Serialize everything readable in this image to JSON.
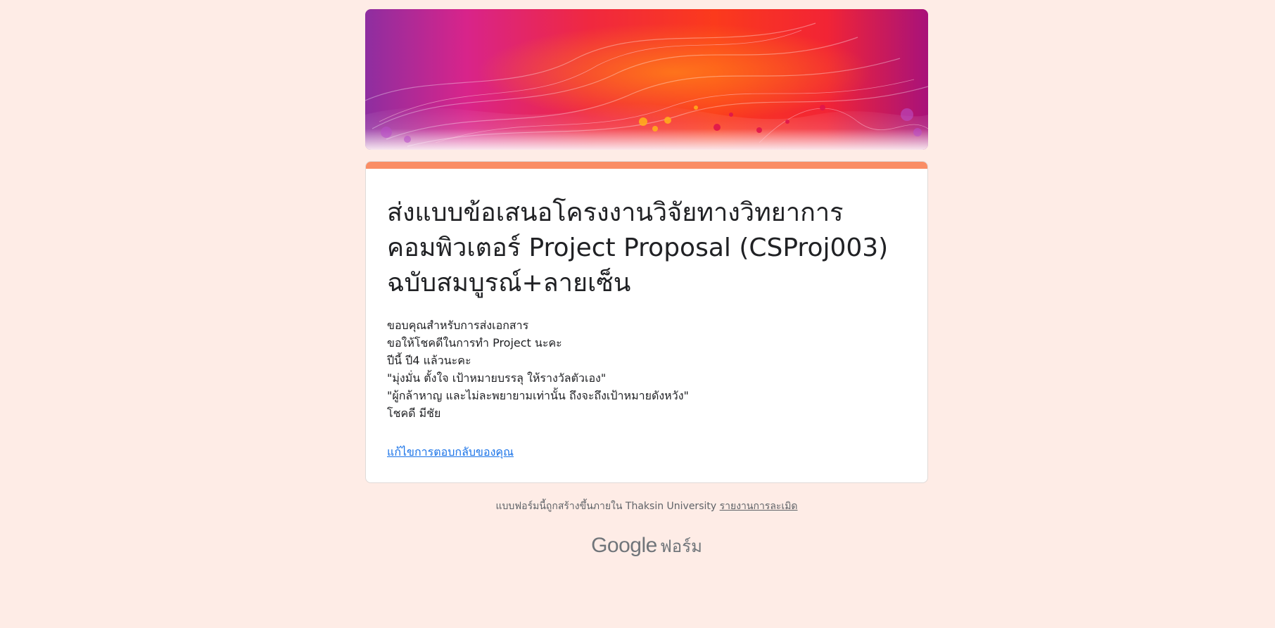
{
  "form": {
    "title": "ส่งแบบข้อเสนอโครงงานวิจัยทางวิทยาการคอมพิวเตอร์ Project Proposal (CSProj003) ฉบับสมบูรณ์+ลายเซ็น",
    "confirmation_lines": [
      "ขอบคุณสำหรับการส่งเอกสาร",
      "ขอให้โชคดีในการทำ Project นะคะ",
      "ปีนี้ ปี4 แล้วนะคะ",
      "\"มุ่งมั่น ตั้งใจ เป้าหมายบรรลุ ให้รางวัลตัวเอง\"",
      "\"ผู้กล้าหาญ และไม่ละพยายามเท่านั้น ถึงจะถึงเป้าหมายดังหวัง\"",
      "โชคดี มีชัย"
    ],
    "edit_response_link": "แก้ไขการตอบกลับของคุณ"
  },
  "footer": {
    "created_text": "แบบฟอร์มนี้ถูกสร้างขึ้นภายใน Thaksin University",
    "report_link": "รายงานการละเมิด"
  },
  "brand": {
    "google": "Google",
    "forms": "ฟอร์ม"
  },
  "colors": {
    "page_background": "#feece6",
    "accent": "#fa8d65",
    "link": "#1a73e8"
  }
}
